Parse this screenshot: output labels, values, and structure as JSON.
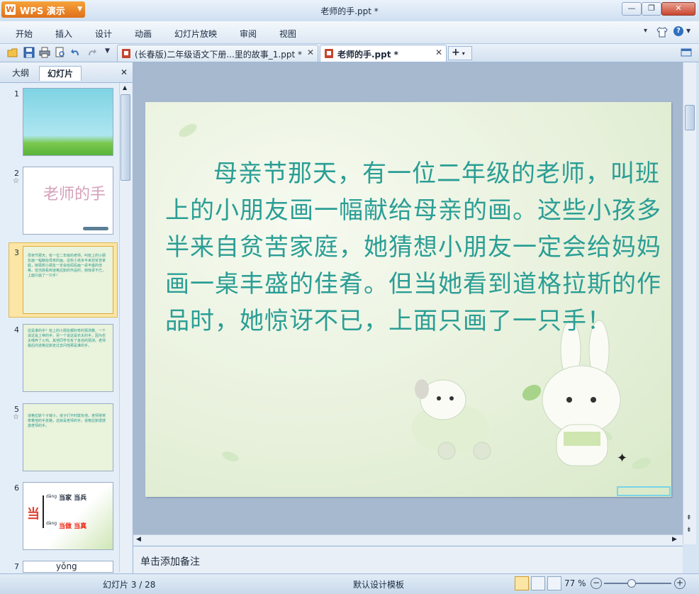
{
  "app": {
    "name": "WPS 演示",
    "window_title": "老师的手.ppt *"
  },
  "window_controls": {
    "minimize": "—",
    "restore": "❐",
    "close": "✕"
  },
  "menu": [
    "开始",
    "插入",
    "设计",
    "动画",
    "幻灯片放映",
    "审阅",
    "视图"
  ],
  "tabs": [
    {
      "label": "(长春版)二年级语文下册...里的故事_1.ppt *",
      "close": "✕"
    },
    {
      "label": "老师的手.ppt *",
      "close": "✕"
    }
  ],
  "panel": {
    "tab_outline": "大纲",
    "tab_slides": "幻灯片",
    "close": "✕"
  },
  "thumbnails": [
    {
      "num": "1",
      "star": ""
    },
    {
      "num": "2",
      "star": "☆",
      "text": "老师的手"
    },
    {
      "num": "3",
      "star": "",
      "text": "母亲节那天，有一位二年级的老师，叫班上的小朋友画一幅献给母亲的画。这些小孩多半来自贫苦家庭，她猜想小朋友一定会给妈妈画一桌丰盛的佳肴。但当她看到道格拉斯的作品时，她惊讶不已，上面只画了一只手！"
    },
    {
      "num": "4",
      "star": "",
      "text": "这是谁的手？班上的小朋友都好奇的猜测着。一个说这是上帝的手。另一个说这是农夫的手，因为农夫喂养了火鸡。其他同学也有了各自的猜测。老师最后向道格拉斯走过去问他那是谁的手。"
    },
    {
      "num": "5",
      "star": "☆",
      "text": "道格拉斯个子矮小，孩子们不时欺负他。老师常常牵着他的手走路，这就是老师的手。道格拉斯很感激老师的手。"
    },
    {
      "num": "6",
      "star": "",
      "text": "当",
      "pinyin1": "dāng",
      "words1": "当家 当兵",
      "pinyin2": "dàng",
      "words2": "当做 当真"
    },
    {
      "num": "7",
      "star": "",
      "pinyin": "yǒng"
    }
  ],
  "slide": {
    "text": "母亲节那天，有一位二年级的老师，叫班上的小朋友画一幅献给母亲的画。这些小孩多半来自贫苦家庭，她猜想小朋友一定会给妈妈画一桌丰盛的佳肴。但当她看到道格拉斯的作品时，她惊讶不已，上面只画了一只手！",
    "text_color": "#2b9e95"
  },
  "notes_placeholder": "单击添加备注",
  "status": {
    "slide_counter": "幻灯片 3 / 28",
    "template": "默认设计模板",
    "zoom": "77 %",
    "zoom_level": 0.77
  },
  "colors": {
    "accent": "#e0701b",
    "chrome": "#d6e4f3",
    "selection": "#fbe6a5"
  }
}
